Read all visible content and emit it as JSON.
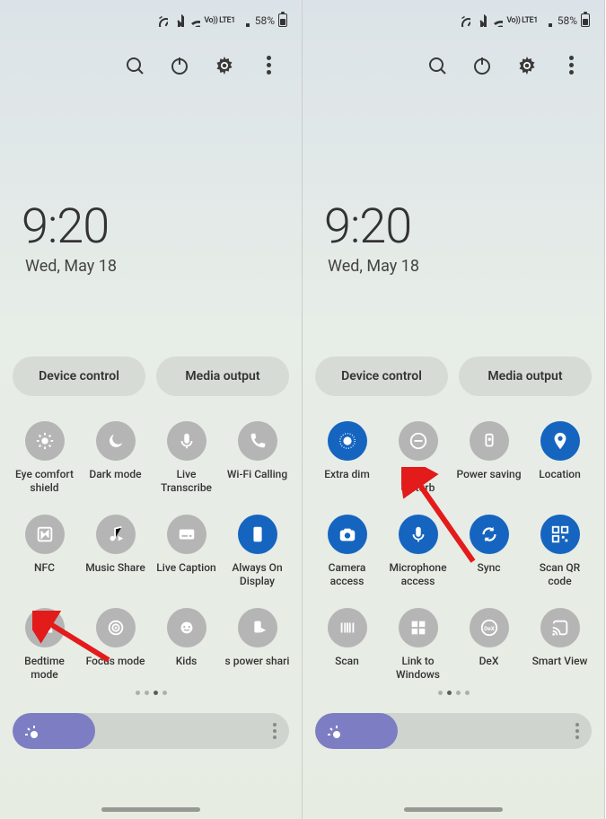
{
  "status": {
    "net_label": "Vo)) LTE1",
    "battery": "58%"
  },
  "header": {
    "time": "9:20",
    "date": "Wed, May 18"
  },
  "pills": {
    "device": "Device control",
    "media": "Media output"
  },
  "left": {
    "tiles": [
      {
        "label": "Eye comfort shield",
        "icon": "sun-icon",
        "on": false
      },
      {
        "label": "Dark mode",
        "icon": "moon-icon",
        "on": false
      },
      {
        "label": "Live Transcribe",
        "icon": "mic-text-icon",
        "on": false
      },
      {
        "label": "Wi-Fi Calling",
        "icon": "phone-wifi-icon",
        "on": false
      },
      {
        "label": "NFC",
        "icon": "nfc-icon",
        "on": false
      },
      {
        "label": "Music Share",
        "icon": "music-share-icon",
        "on": false
      },
      {
        "label": "Live Caption",
        "icon": "caption-icon",
        "on": false
      },
      {
        "label": "Always On Display",
        "icon": "aod-icon",
        "on": true
      },
      {
        "label": "Bedtime mode",
        "icon": "bed-icon",
        "on": false
      },
      {
        "label": "Focus mode",
        "icon": "target-icon",
        "on": false
      },
      {
        "label": "Kids",
        "icon": "kids-icon",
        "on": false
      },
      {
        "label": "s power shari",
        "icon": "power-share-icon",
        "on": false
      }
    ],
    "active_page": 2
  },
  "right": {
    "tiles": [
      {
        "label": "Extra dim",
        "icon": "dim-icon",
        "on": true
      },
      {
        "label": "Do not disturb",
        "icon": "dnd-icon",
        "on": false
      },
      {
        "label": "Power saving",
        "icon": "leaf-icon",
        "on": false
      },
      {
        "label": "Location",
        "icon": "location-icon",
        "on": true
      },
      {
        "label": "Camera access",
        "icon": "camera-icon",
        "on": true
      },
      {
        "label": "Microphone access",
        "icon": "mic-icon",
        "on": true
      },
      {
        "label": "Sync",
        "icon": "sync-icon",
        "on": true
      },
      {
        "label": "Scan QR code",
        "icon": "qr-icon",
        "on": true
      },
      {
        "label": "Scan",
        "icon": "barcode-icon",
        "on": false
      },
      {
        "label": "Link to Windows",
        "icon": "windows-icon",
        "on": false
      },
      {
        "label": "DeX",
        "icon": "dex-icon",
        "on": false
      },
      {
        "label": "Smart View",
        "icon": "cast-icon",
        "on": false
      }
    ],
    "active_page": 1
  },
  "brightness_percent": 30,
  "arrow_color": "#e31b1b"
}
